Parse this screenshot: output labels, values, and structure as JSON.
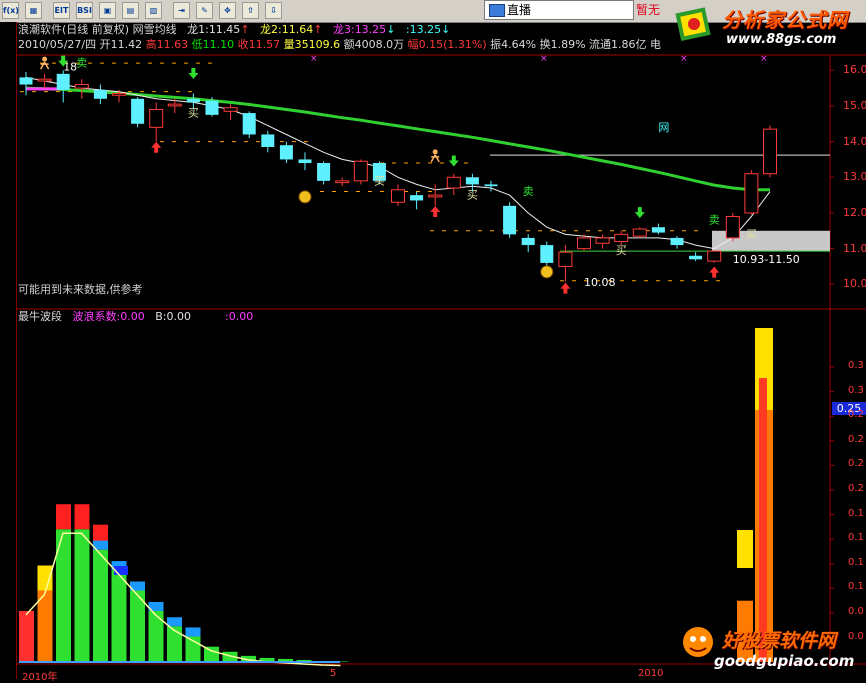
{
  "toolbar": {
    "buttons": [
      "f(x)",
      "▦",
      "EIT",
      "BSI",
      "▣",
      "▤",
      "▧",
      "⇥",
      "✎",
      "✥",
      "⇧",
      "⇩"
    ],
    "live_tab": "直播",
    "no_quote": "暂无"
  },
  "brand_top": {
    "title": "分析家公式网",
    "url": "www.88gs.com"
  },
  "brand_bottom": {
    "title": "好股票软件网",
    "url": "goodgupiao.com"
  },
  "header": {
    "line1": {
      "app": "浪潮软件(日线 前复权)",
      "indicator": "网雪均线",
      "l1_label": "龙1:",
      "l1_value": "11.45",
      "l1_arrow": "↑",
      "l2_label": "龙2:",
      "l2_value": "11.64",
      "l2_arrow": "↑",
      "l3_label": "龙3:",
      "l3_value": "13.25",
      "l3_arrow": "↓",
      "l4_label": ":",
      "l4_value": "13.25",
      "l4_arrow": "↓"
    },
    "line2": {
      "date": "2010/05/27/四",
      "open_label": "开",
      "open": "11.42",
      "high_label": "高",
      "high": "11.63",
      "low_label": "低",
      "low": "11.10",
      "close_label": "收",
      "close": "11.57",
      "vol_label": "量",
      "vol": "35109.6",
      "amt_label": "额",
      "amt": "4008.0万",
      "chg_label": "幅",
      "chg": "0.15(1.31%)",
      "amp_label": "振",
      "amp": "4.64%",
      "turn_label": "换",
      "turn": "1.89%",
      "float_label": "流通",
      "float": "1.86亿",
      "extra": "电"
    }
  },
  "notice": "可能用到未来数据,供参考",
  "sub_header": {
    "name": "最牛波段",
    "coef_label": "波浪系数:",
    "coef": "0.00",
    "b_label": "B:",
    "b": "0.00",
    "c_label": ":",
    "c": "0.00"
  },
  "current_value_tag": "0.25",
  "x_labels": [
    "2010年",
    "5",
    "2010"
  ],
  "chart_data": [
    {
      "type": "candlestick",
      "title": "浪潮软件(日线 前复权)",
      "y_ticks": [
        "16.0",
        "15.0",
        "14.0",
        "13.0",
        "12.0",
        "11.0",
        "10.0"
      ],
      "ylim": [
        9.7,
        16.4
      ],
      "candles": [
        {
          "o": 15.8,
          "c": 15.6,
          "h": 15.95,
          "l": 15.3
        },
        {
          "o": 15.7,
          "c": 15.75,
          "h": 15.9,
          "l": 15.5
        },
        {
          "o": 15.9,
          "c": 15.45,
          "h": 16.0,
          "l": 15.1
        },
        {
          "o": 15.5,
          "c": 15.6,
          "h": 15.75,
          "l": 15.2
        },
        {
          "o": 15.45,
          "c": 15.2,
          "h": 15.6,
          "l": 15.05
        },
        {
          "o": 15.3,
          "c": 15.35,
          "h": 15.45,
          "l": 15.1
        },
        {
          "o": 15.2,
          "c": 14.5,
          "h": 15.25,
          "l": 14.4
        },
        {
          "o": 14.4,
          "c": 14.9,
          "h": 15.1,
          "l": 14.0
        },
        {
          "o": 15.0,
          "c": 15.05,
          "h": 15.2,
          "l": 14.8
        },
        {
          "o": 15.2,
          "c": 15.1,
          "h": 15.35,
          "l": 14.9
        },
        {
          "o": 15.15,
          "c": 14.75,
          "h": 15.25,
          "l": 14.7
        },
        {
          "o": 14.85,
          "c": 14.95,
          "h": 15.05,
          "l": 14.6
        },
        {
          "o": 14.8,
          "c": 14.2,
          "h": 14.85,
          "l": 14.1
        },
        {
          "o": 14.2,
          "c": 13.85,
          "h": 14.3,
          "l": 13.7
        },
        {
          "o": 13.9,
          "c": 13.5,
          "h": 14.0,
          "l": 13.4
        },
        {
          "o": 13.5,
          "c": 13.4,
          "h": 13.7,
          "l": 13.2
        },
        {
          "o": 13.4,
          "c": 12.9,
          "h": 13.45,
          "l": 12.8
        },
        {
          "o": 12.85,
          "c": 12.9,
          "h": 13.0,
          "l": 12.75
        },
        {
          "o": 12.9,
          "c": 13.45,
          "h": 13.5,
          "l": 12.8
        },
        {
          "o": 13.4,
          "c": 12.9,
          "h": 13.45,
          "l": 12.8
        },
        {
          "o": 12.3,
          "c": 12.65,
          "h": 12.8,
          "l": 12.2
        },
        {
          "o": 12.5,
          "c": 12.35,
          "h": 12.6,
          "l": 12.1
        },
        {
          "o": 12.45,
          "c": 12.5,
          "h": 12.8,
          "l": 12.2
        },
        {
          "o": 12.7,
          "c": 13.0,
          "h": 13.1,
          "l": 12.5
        },
        {
          "o": 13.0,
          "c": 12.8,
          "h": 13.1,
          "l": 12.6
        },
        {
          "o": 12.8,
          "c": 12.75,
          "h": 12.9,
          "l": 12.6
        },
        {
          "o": 12.2,
          "c": 11.4,
          "h": 12.3,
          "l": 11.3
        },
        {
          "o": 11.3,
          "c": 11.1,
          "h": 11.4,
          "l": 10.9
        },
        {
          "o": 11.1,
          "c": 10.6,
          "h": 11.2,
          "l": 10.5
        },
        {
          "o": 10.5,
          "c": 10.9,
          "h": 11.1,
          "l": 10.08
        },
        {
          "o": 11.0,
          "c": 11.3,
          "h": 11.4,
          "l": 10.95
        },
        {
          "o": 11.15,
          "c": 11.3,
          "h": 11.4,
          "l": 11.0
        },
        {
          "o": 11.2,
          "c": 11.4,
          "h": 11.5,
          "l": 11.1
        },
        {
          "o": 11.35,
          "c": 11.55,
          "h": 11.6,
          "l": 11.3
        },
        {
          "o": 11.6,
          "c": 11.45,
          "h": 11.7,
          "l": 11.4
        },
        {
          "o": 11.3,
          "c": 11.1,
          "h": 11.35,
          "l": 11.0
        },
        {
          "o": 10.8,
          "c": 10.7,
          "h": 10.9,
          "l": 10.65
        },
        {
          "o": 10.65,
          "c": 10.93,
          "h": 10.95,
          "l": 10.6
        },
        {
          "o": 11.3,
          "c": 11.9,
          "h": 12.0,
          "l": 11.2
        },
        {
          "o": 12.0,
          "c": 13.1,
          "h": 13.2,
          "l": 11.95
        },
        {
          "o": 13.1,
          "c": 14.35,
          "h": 14.45,
          "l": 13.0
        }
      ],
      "ma_long": [
        15.5,
        15.48,
        15.46,
        15.43,
        15.4,
        15.36,
        15.32,
        15.28,
        15.24,
        15.2,
        15.15,
        15.1,
        15.04,
        14.97,
        14.9,
        14.83,
        14.75,
        14.67,
        14.6,
        14.52,
        14.44,
        14.36,
        14.28,
        14.2,
        14.12,
        14.03,
        13.94,
        13.85,
        13.76,
        13.66,
        13.56,
        13.46,
        13.36,
        13.25,
        13.14,
        13.02,
        12.9,
        12.78,
        12.7,
        12.65,
        12.65
      ],
      "ma_short": [
        15.8,
        15.7,
        15.6,
        15.5,
        15.45,
        15.4,
        15.3,
        15.2,
        15.15,
        15.1,
        15.0,
        14.9,
        14.7,
        14.45,
        14.2,
        13.95,
        13.7,
        13.5,
        13.4,
        13.3,
        13.0,
        12.8,
        12.65,
        12.7,
        12.75,
        12.7,
        12.5,
        12.0,
        11.6,
        11.4,
        11.35,
        11.3,
        11.3,
        11.3,
        11.3,
        11.25,
        11.1,
        11.0,
        11.3,
        11.9,
        12.6
      ],
      "labels": [
        {
          "text": "18",
          "i": 2,
          "y": 16.0,
          "color": "#ffffff"
        },
        {
          "text": "网",
          "i": 34,
          "y": 14.3,
          "color": "#40ffff"
        },
        {
          "text": "10.08",
          "i": 30,
          "y": 9.95,
          "color": "#ffffff"
        },
        {
          "text": "10.93-11.50",
          "i": 38,
          "y": 10.6,
          "color": "#ffffff"
        }
      ],
      "buy_marks": [
        {
          "text": "买",
          "i": 9,
          "y": 14.7
        },
        {
          "text": "买",
          "i": 19,
          "y": 12.8
        },
        {
          "text": "买",
          "i": 24,
          "y": 12.4
        },
        {
          "text": "买",
          "i": 32,
          "y": 10.85
        },
        {
          "text": "买",
          "i": 39,
          "y": 11.3
        }
      ],
      "sell_marks": [
        {
          "text": "卖",
          "i": 3,
          "y": 16.1
        },
        {
          "text": "卖",
          "i": 27,
          "y": 12.5
        },
        {
          "text": "卖",
          "i": 37,
          "y": 11.7
        }
      ]
    },
    {
      "type": "bar",
      "title": "最牛波段",
      "y_ticks": [
        "0.3",
        "0.3",
        "0.2",
        "0.2",
        "0.2",
        "0.2",
        "0.1",
        "0.1",
        "0.1",
        "0.1",
        "0.0",
        "0.0"
      ],
      "ylim": [
        0,
        0.33
      ],
      "bars_left": [
        0.05,
        0.07,
        0.13,
        0.13,
        0.11,
        0.09,
        0.07,
        0.05,
        0.035,
        0.025,
        0.015,
        0.01,
        0.006,
        0.004,
        0.003,
        0.002,
        0.001,
        0.0005
      ],
      "bars_right": [
        0.06,
        0.28
      ]
    }
  ]
}
